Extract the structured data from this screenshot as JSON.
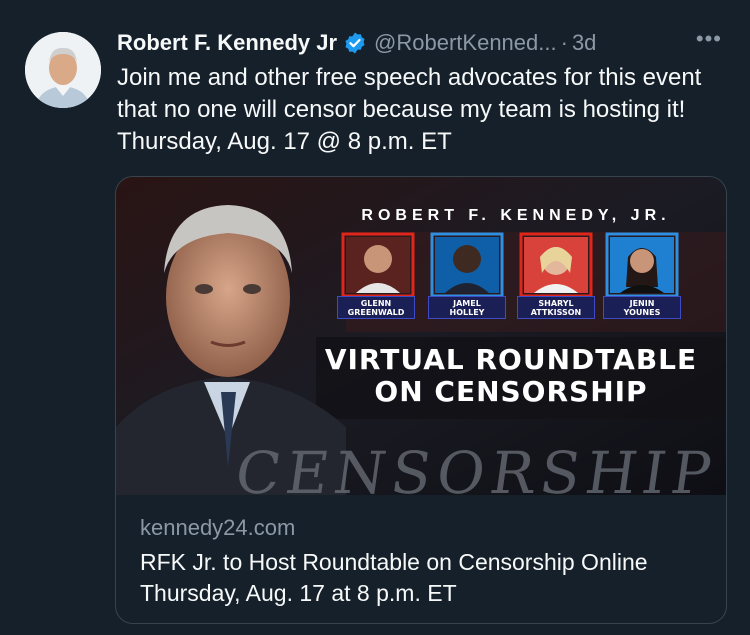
{
  "tweet": {
    "author_name": "Robert F. Kennedy Jr",
    "handle": "@RobertKenned...",
    "separator": "·",
    "time": "3d",
    "more_label": "•••",
    "text": "Join me and other free speech advocates for this event that no one will censor because my team is hosting it! Thursday, Aug. 17 @ 8 p.m. ET"
  },
  "card": {
    "image": {
      "top_text": "ROBERT F. KENNEDY, JR.",
      "panelists": [
        {
          "label_line1": "GLENN",
          "label_line2": "GREENWALD",
          "frame_color": "#e0251b"
        },
        {
          "label_line1": "JAMEL",
          "label_line2": "HOLLEY",
          "frame_color": "#2f8fe0"
        },
        {
          "label_line1": "SHARYL",
          "label_line2": "ATTKISSON",
          "frame_color": "#e0251b"
        },
        {
          "label_line1": "JENIN",
          "label_line2": "YOUNES",
          "frame_color": "#2f8fe0"
        }
      ],
      "headline_line1": "VIRTUAL ROUNDTABLE",
      "headline_line2": "ON CENSORSHIP",
      "background_word": "CENSORSHIP"
    },
    "domain": "kennedy24.com",
    "title": "RFK Jr. to Host Roundtable on Censorship Online Thursday, Aug. 17 at 8 p.m. ET"
  },
  "colors": {
    "background": "#15202b",
    "verified_badge": "#1d9bf0",
    "secondary_text": "#8b98a5"
  }
}
